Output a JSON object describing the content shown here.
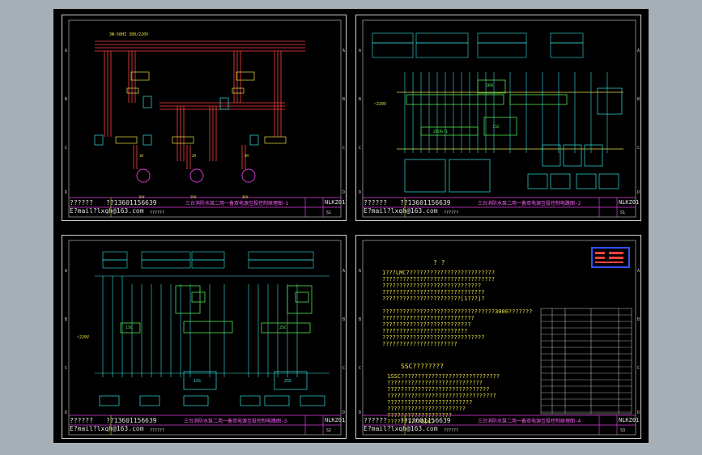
{
  "sheets": [
    {
      "id": "sheet1",
      "designer": "??????",
      "phone": "??13601156639",
      "email": "E?mail?lxqh@163.com",
      "email_extra": "??????",
      "title": "三台消防水泵二用一备双电源互投控制原理图-1",
      "code": "NLKZ01",
      "page": "S1",
      "labels": {
        "supply": "3Φ-50HZ 380/220V"
      }
    },
    {
      "id": "sheet2",
      "designer": "??????",
      "phone": "??13601156639",
      "email": "E?mail?lxqh@163.com",
      "email_extra": "??????",
      "title": "三台消防水泵二用一备双电源互投控制电路图-2",
      "code": "NLKZ01",
      "page": "S1",
      "labels": {
        "left": "~220V",
        "unit1": "1SC",
        "unit2": "1KA",
        "unit3": "2EUG-1"
      }
    },
    {
      "id": "sheet3",
      "designer": "??????",
      "phone": "??13601156639",
      "email": "E?mail?lxqh@163.com",
      "email_extra": "??????",
      "title": "三台消防水泵二用一备双电源互投控制电路图-3",
      "code": "NLKZ01",
      "page": "S2",
      "labels": {
        "left": "~220V",
        "u1": "1SC",
        "u2": "2SC",
        "b1": "1SS",
        "b2": "2SS"
      }
    },
    {
      "id": "sheet4",
      "designer": "??????",
      "phone": "??13601156639",
      "email": "E?mail?lxqh@163.com",
      "email_extra": "??????",
      "title": "三台消防水泵二用一备双电源互投控制原理图-4",
      "code": "NLKZ01",
      "page": "S3",
      "note_heading": "?          ?",
      "notes_a": [
        "1???LMC??????????????????????????",
        "   ?????????????????????????????????",
        "   ?????????????????????????????",
        "   ??????????????????????????????",
        "   ???????????????????????[1???]?",
        "",
        "?????????????????????????????????3000???????",
        "???????????????????????????",
        "   ??????????????????????????",
        "?????????????????????????",
        "??????????????????????????????",
        "??????????????????????"
      ],
      "ssc_heading": "SSC????????",
      "notes_b": [
        "1SSC?????????????????????????????",
        "????????????????????????????",
        "??????????????????????????????",
        "????????????????????????????????",
        "?????????????????????????",
        "???????????????????????",
        "???????????????????",
        "??????????DDC?"
      ]
    }
  ]
}
